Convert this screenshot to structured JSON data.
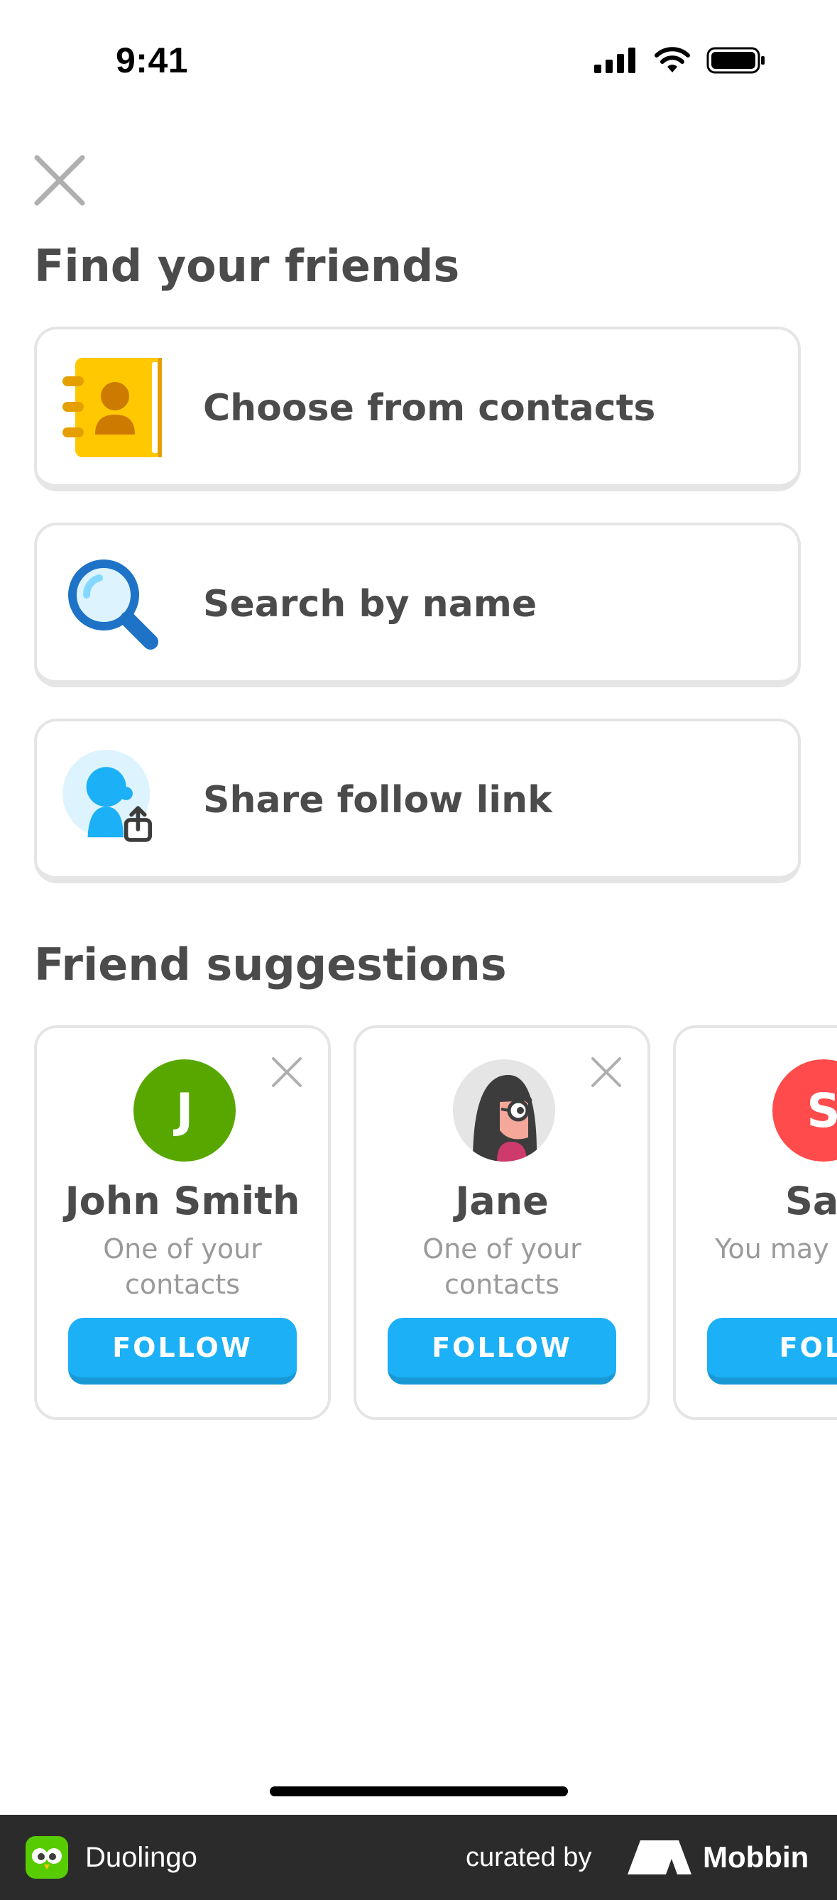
{
  "status_bar": {
    "time": "9:41"
  },
  "header": {
    "close_icon": "close-icon"
  },
  "find_friends": {
    "title": "Find your friends",
    "options": [
      {
        "label": "Choose from contacts",
        "icon": "contacts-book-icon"
      },
      {
        "label": "Search by name",
        "icon": "magnifier-icon"
      },
      {
        "label": "Share follow link",
        "icon": "share-profile-icon"
      }
    ]
  },
  "suggestions": {
    "title": "Friend suggestions",
    "items": [
      {
        "avatar_letter": "J",
        "avatar_color": "#58a700",
        "name": "John Smith",
        "reason": "One of your contacts",
        "follow_label": "FOLLOW"
      },
      {
        "avatar_letter": "",
        "avatar_color": "#e5e5e5",
        "name": "Jane",
        "reason": "One of your contacts",
        "follow_label": "FOLLOW"
      },
      {
        "avatar_letter": "S",
        "avatar_color": "#ff4b4b",
        "name": "Sar",
        "reason": "You may each o",
        "follow_label": "FOLL"
      }
    ]
  },
  "footer": {
    "app_name": "Duolingo",
    "curated_by": "curated by",
    "brand": "Mobbin"
  },
  "colors": {
    "follow_blue": "#1cb0f6",
    "text_dark": "#4b4b4b",
    "text_muted": "#9a9a9a",
    "card_border": "#e5e5e5"
  }
}
